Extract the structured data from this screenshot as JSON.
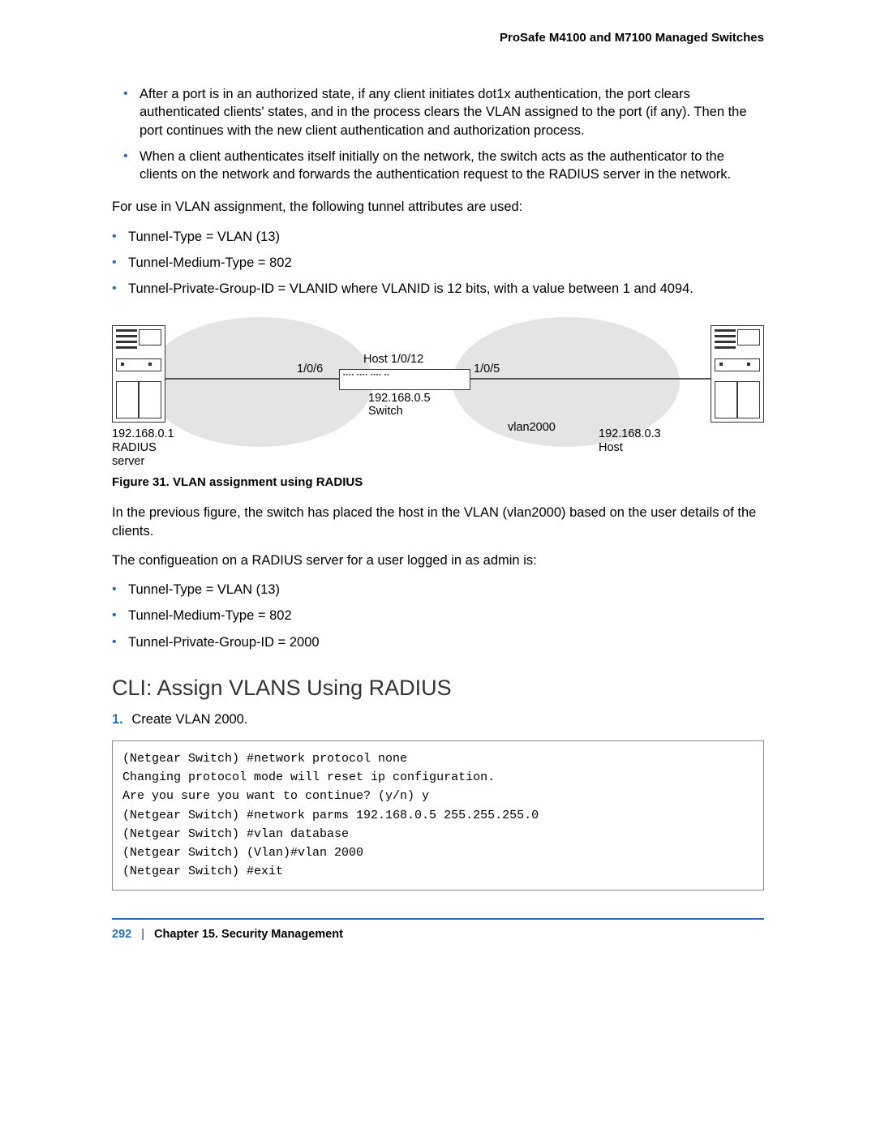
{
  "header": {
    "title": "ProSafe M4100 and M7100 Managed Switches"
  },
  "intro_bullets": [
    "After a port is in an authorized state, if any client initiates dot1x authentication, the port clears authenticated clients' states, and in the process clears the VLAN assigned to the port (if any). Then the port continues with the new client authentication and authorization process.",
    "When a client authenticates itself initially on the network, the switch acts as the authenticator to the clients on the network and forwards the authentication request to the RADIUS server in the network."
  ],
  "para_attrs": "For use in VLAN assignment, the following tunnel attributes are used:",
  "attrs_list": [
    "Tunnel-Type = VLAN (13)",
    "Tunnel-Medium-Type = 802",
    "Tunnel-Private-Group-ID = VLANID where VLANID is 12 bits, with a value between 1 and 4094."
  ],
  "figure": {
    "lbl_port_left": "1/0/6",
    "lbl_host_port": "Host 1/0/12",
    "lbl_port_right": "1/0/5",
    "lbl_switch_ip": "192.168.0.5",
    "lbl_switch": "Switch",
    "lbl_vlan": "vlan2000",
    "lbl_radius_ip": "192.168.0.1",
    "lbl_radius": "RADIUS",
    "lbl_server": "server",
    "lbl_host_ip": "192.168.0.3",
    "lbl_host": "Host",
    "caption": "Figure 31. VLAN assignment using RADIUS"
  },
  "para_after_fig": "In the previous figure, the switch has placed the host in the VLAN (vlan2000) based on the user details of the clients.",
  "para_config": "The configueation on a RADIUS server for a user logged in as admin is:",
  "config_list": [
    "Tunnel-Type = VLAN (13)",
    "Tunnel-Medium-Type = 802",
    "Tunnel-Private-Group-ID = 2000"
  ],
  "section_heading": "CLI: Assign VLANS Using RADIUS",
  "step1": {
    "num": "1.",
    "text": "Create VLAN 2000."
  },
  "code": "(Netgear Switch) #network protocol none\nChanging protocol mode will reset ip configuration.\nAre you sure you want to continue? (y/n) y\n(Netgear Switch) #network parms 192.168.0.5 255.255.255.0\n(Netgear Switch) #vlan database\n(Netgear Switch) (Vlan)#vlan 2000\n(Netgear Switch) #exit",
  "footer": {
    "page": "292",
    "sep": "|",
    "chapter": "Chapter 15.  Security Management"
  }
}
